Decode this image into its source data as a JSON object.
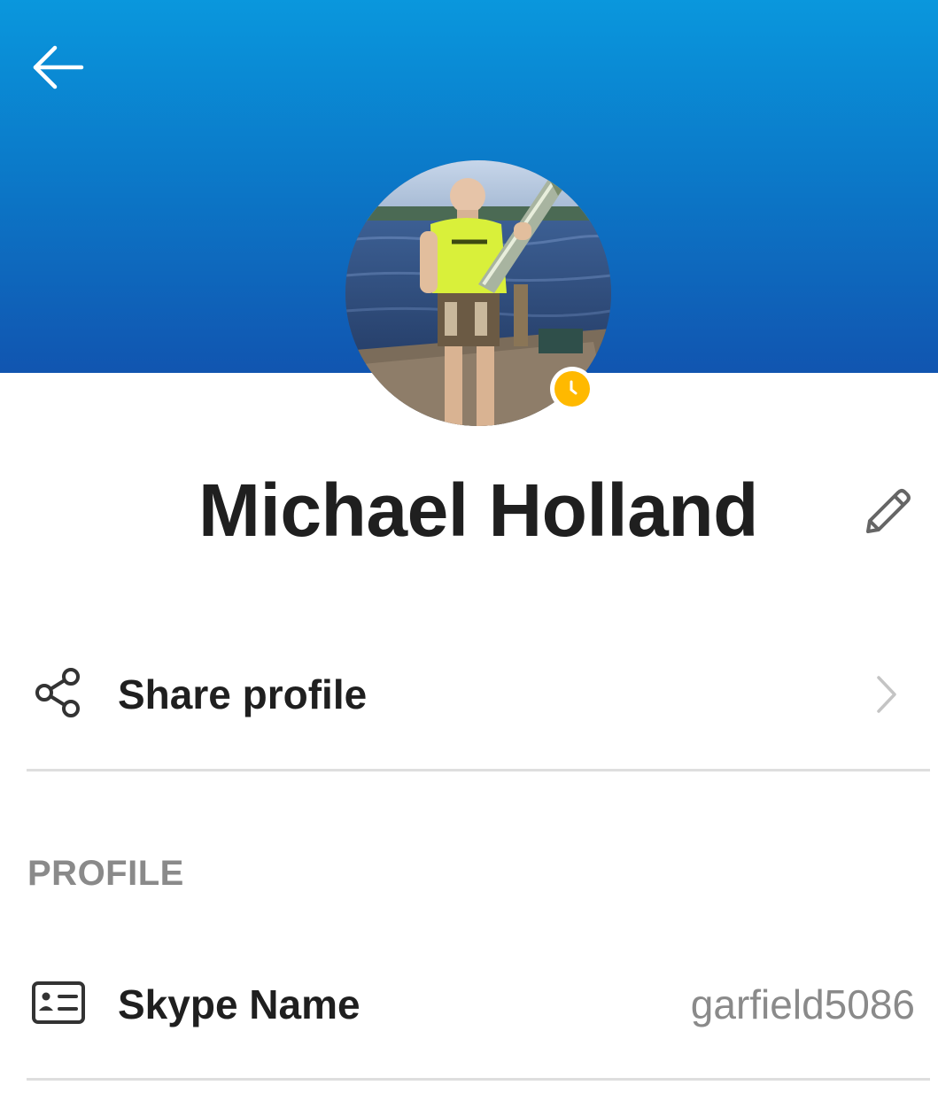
{
  "header": {
    "back_icon": "arrow-left-icon",
    "gradient_top": "#0a97dd",
    "gradient_bottom": "#1155b0"
  },
  "profile": {
    "display_name": "Michael Holland",
    "presence_status": "away",
    "presence_color": "#ffb900",
    "edit_icon": "pencil-icon"
  },
  "actions": {
    "share_profile_label": "Share profile",
    "share_icon": "share-icon",
    "chevron_icon": "chevron-right-icon"
  },
  "section": {
    "title": "PROFILE"
  },
  "fields": [
    {
      "label": "Skype Name",
      "value": "garfield5086",
      "icon": "id-card-icon"
    }
  ]
}
